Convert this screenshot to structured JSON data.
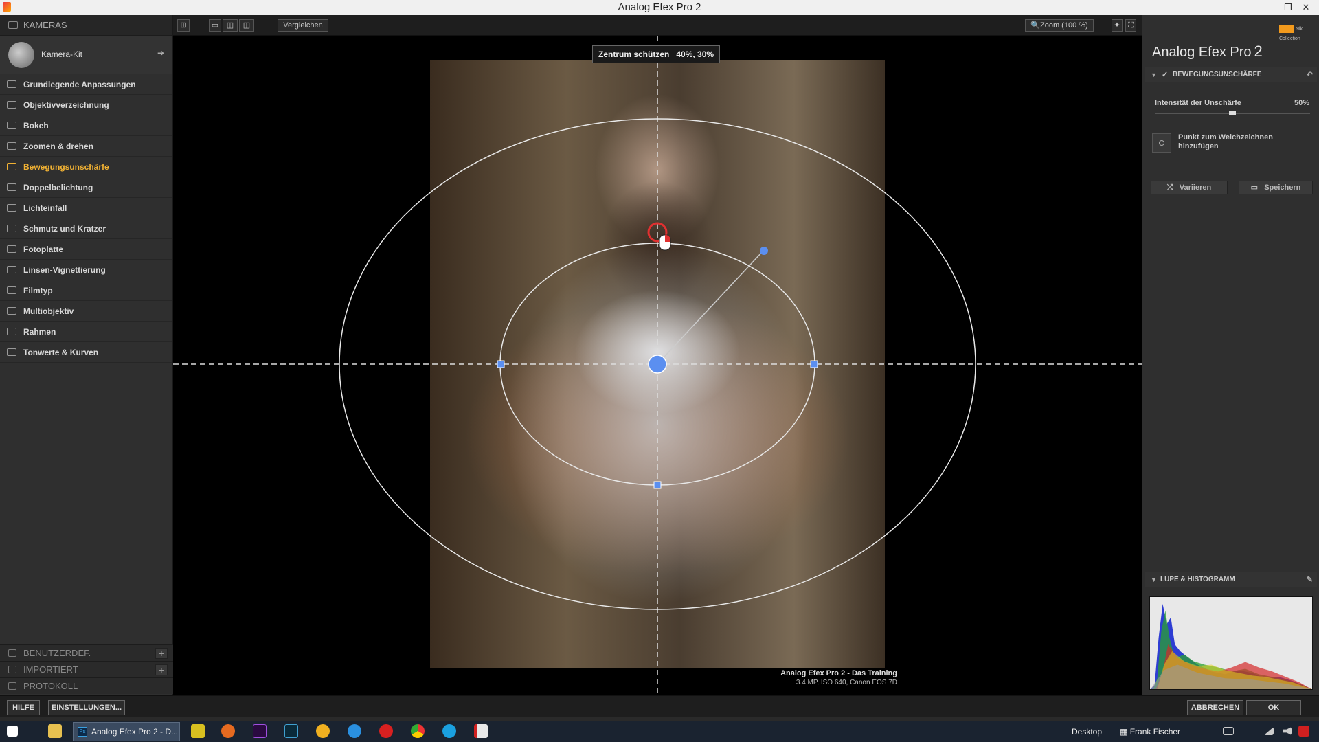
{
  "window": {
    "title": "Analog Efex Pro 2",
    "controls": [
      "–",
      "❐",
      "✕"
    ]
  },
  "left_panel": {
    "header": "KAMERAS",
    "camera_kit": "Kamera-Kit",
    "filters": [
      {
        "label": "Grundlegende Anpassungen",
        "icon": "sliders-icon",
        "active": false
      },
      {
        "label": "Objektivverzeichnung",
        "icon": "lens-distortion-icon",
        "active": false
      },
      {
        "label": "Bokeh",
        "icon": "eye-icon",
        "active": false
      },
      {
        "label": "Zoomen & drehen",
        "icon": "rotate-icon",
        "active": false
      },
      {
        "label": "Bewegungsunschärfe",
        "icon": "motion-blur-icon",
        "active": true
      },
      {
        "label": "Doppelbelichtung",
        "icon": "double-exposure-icon",
        "active": false
      },
      {
        "label": "Lichteinfall",
        "icon": "light-leak-icon",
        "active": false
      },
      {
        "label": "Schmutz und Kratzer",
        "icon": "dust-scratches-icon",
        "active": false
      },
      {
        "label": "Fotoplatte",
        "icon": "photo-plate-icon",
        "active": false
      },
      {
        "label": "Linsen-Vignettierung",
        "icon": "vignette-icon",
        "active": false
      },
      {
        "label": "Filmtyp",
        "icon": "film-type-icon",
        "active": false
      },
      {
        "label": "Multiobjektiv",
        "icon": "multi-lens-icon",
        "active": false
      },
      {
        "label": "Rahmen",
        "icon": "frame-icon",
        "active": false
      },
      {
        "label": "Tonwerte & Kurven",
        "icon": "curves-icon",
        "active": false
      }
    ],
    "sections": [
      {
        "label": "BENUTZERDEF.",
        "has_plus": true
      },
      {
        "label": "IMPORTIERT",
        "has_plus": true
      },
      {
        "label": "PROTOKOLL",
        "has_plus": false
      }
    ]
  },
  "toolbar": {
    "compare_label": "Vergleichen",
    "zoom_label": "Zoom (100 %)"
  },
  "canvas": {
    "tooltip_label": "Zentrum schützen",
    "tooltip_value": "40%, 30%",
    "caption_title": "Analog Efex Pro 2 - Das Training",
    "caption_meta": "3.4 MP, ISO 640, Canon EOS 7D"
  },
  "right_panel": {
    "title": "Analog Efex Pro",
    "title_version": "2",
    "badge": "Nik Collection",
    "section_title": "BEWEGUNGSUNSCHÄRFE",
    "slider_label": "Intensität der Unschärfe",
    "slider_value": "50%",
    "slider_fraction": 0.5,
    "add_point_label": "Punkt zum Weichzeichnen hinzufügen",
    "vary_label": "Variieren",
    "save_label": "Speichern",
    "histogram_title": "LUPE & HISTOGRAMM"
  },
  "bottom_bar": {
    "help_label": "HILFE",
    "settings_label": "EINSTELLUNGEN...",
    "cancel_label": "ABBRECHEN",
    "ok_label": "OK"
  },
  "taskbar": {
    "active_task": "Analog Efex Pro 2 - D...",
    "desktop_label": "Desktop",
    "user_label": "Frank Fischer"
  },
  "colors": {
    "accent": "#f2b233",
    "handle_blue": "#5b8ff0"
  }
}
